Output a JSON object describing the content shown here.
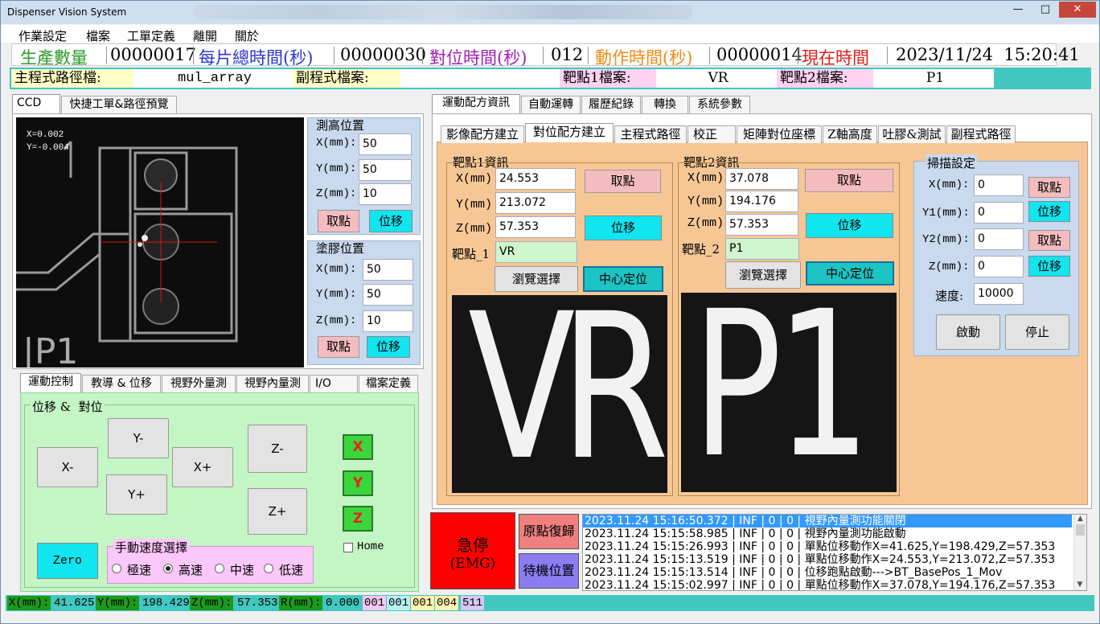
{
  "window": {
    "title": "Dispenser Vision System"
  },
  "menu": [
    "作業設定",
    "檔案",
    "工單定義",
    "離開",
    "關於"
  ],
  "stats": {
    "prod_label": "生產數量",
    "prod_value": "00000017",
    "total_label": "每片總時間(秒)",
    "total_value": "00000030",
    "align_label": "對位時間(秒)",
    "align_value": "012",
    "action_label": "動作時間(秒)",
    "action_value": "00000014",
    "now_label": "現在時間",
    "now_value": "2023/11/24  15:20:41"
  },
  "paths": {
    "main_label": "主程式路徑檔:",
    "main_value": "mul_array",
    "sub_label": "副程式檔案:",
    "sub_value": "",
    "t1_label": "靶點1檔案:",
    "t1_value": "VR",
    "t2_label": "靶點2檔案:",
    "t2_value": "P1"
  },
  "left_tabs": [
    "CCD",
    "快捷工單&路徑預覽"
  ],
  "ccd": {
    "coord_x": "X=0.002",
    "coord_y": "Y=-0.004"
  },
  "measure": {
    "title": "測高位置",
    "x_label": "X(mm):",
    "x": "50",
    "y_label": "Y(mm):",
    "y": "50",
    "z_label": "Z(mm):",
    "z": "10",
    "pick": "取點",
    "move": "位移"
  },
  "glue": {
    "title": "塗膠位置",
    "x_label": "X(mm):",
    "x": "50",
    "y_label": "Y(mm):",
    "y": "50",
    "z_label": "Z(mm):",
    "z": "10",
    "pick": "取點",
    "move": "位移"
  },
  "motion_tabs": [
    "運動控制",
    "教導 & 位移",
    "視野外量測",
    "視野內量測",
    "I/O",
    "檔案定義"
  ],
  "motion": {
    "group_title": "位移 &  對位",
    "xm": "X-",
    "xp": "X+",
    "ym": "Y-",
    "yp": "Y+",
    "zm": "Z-",
    "zp": "Z+",
    "zero": "Zero",
    "ax": "X",
    "ay": "Y",
    "az": "Z",
    "home": "Home",
    "speed_title": "手動速度選擇",
    "speeds": [
      "極速",
      "高速",
      "中速",
      "低速"
    ],
    "speed_selected": "高速"
  },
  "right_tabs": [
    "運動配方資訊",
    "自動運轉",
    "履歷紀錄",
    "轉換",
    "系統參數"
  ],
  "sub_tabs": [
    "影像配方建立",
    "對位配方建立",
    "主程式路徑",
    "校正",
    "矩陣對位座標",
    "Z軸高度",
    "吐膠&測試",
    "副程式路徑"
  ],
  "target1": {
    "title": "靶點1資訊",
    "x_label": "X(mm)",
    "x": "24.553",
    "y_label": "Y(mm)",
    "y": "213.072",
    "z_label": "Z(mm)",
    "z": "57.353",
    "name_label": "靶點_1",
    "name": "VR",
    "pick": "取點",
    "move": "位移",
    "browse": "瀏覽選擇",
    "center": "中心定位",
    "image_text": "VR"
  },
  "target2": {
    "title": "靶點2資訊",
    "x_label": "X(mm)",
    "x": "37.078",
    "y_label": "Y(mm)",
    "y": "194.176",
    "z_label": "Z(mm)",
    "z": "57.353",
    "name_label": "靶點_2",
    "name": "P1",
    "pick": "取點",
    "move": "位移",
    "browse": "瀏覽選擇",
    "center": "中心定位",
    "image_text": "P1"
  },
  "scan": {
    "title": "掃描設定",
    "x_label": "X(mm):",
    "x": "0",
    "y1_label": "Y1(mm):",
    "y1": "0",
    "y2_label": "Y2(mm):",
    "y2": "0",
    "z_label": "Z(mm):",
    "z": "0",
    "speed_label": "速度:",
    "speed": "10000",
    "pick": "取點",
    "move": "位移",
    "start": "啟動",
    "stop": "停止"
  },
  "emg": {
    "line1": "急停",
    "line2": "(EMG)"
  },
  "home_btn": "原點復歸",
  "standby_btn": "待機位置",
  "log": [
    "2023.11.24 15:16:50.372 | INF | 0 | 0 | 視野內量測功能關閉",
    "2023.11.24 15:15:58.985 | INF | 0 | 0 | 視野內量測功能啟動",
    "2023.11.24 15:15:26.993 | INF | 0 | 0 | 單點位移動作X=41.625,Y=198.429,Z=57.353",
    "2023.11.24 15:15:13.519 | INF | 0 | 0 | 單點位移動作X=24.553,Y=213.072,Z=57.353",
    "2023.11.24 15:15:13.514 | INF | 0 | 0 | 位移跑點啟動--->BT_BasePos_1_Mov",
    "2023.11.24 15:15:02.997 | INF | 0 | 0 | 單點位移動作X=37.078,Y=194.176,Z=57.353"
  ],
  "status": {
    "x_label": "X(mm):",
    "x": "41.625",
    "y_label": "Y(mm):",
    "y": "198.429",
    "z_label": "Z(mm):",
    "z": "57.353",
    "r_label": "R(mm):",
    "r": "0.000",
    "c1": "001",
    "c2": "001",
    "c3": "001",
    "c4": "004",
    "c5": "511"
  },
  "colors": {
    "accent": "#41c7bf",
    "cyan_btn": "#11e5ef",
    "pink_btn": "#f5bcc0",
    "green_panel": "#c4f5c4",
    "orange_panel": "#f6c795",
    "emg_red": "#ff0000"
  }
}
